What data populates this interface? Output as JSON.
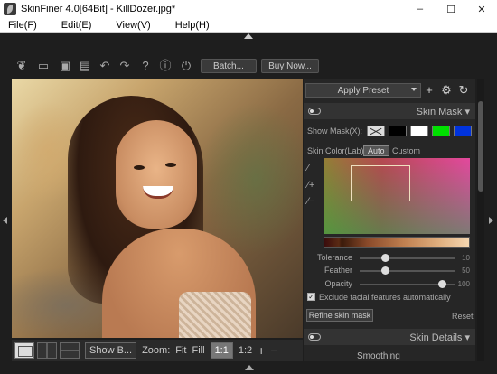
{
  "window": {
    "title": "SkinFiner 4.0[64Bit] - KillDozer.jpg*",
    "minimize": "–",
    "maximize": "☐",
    "close": "✕"
  },
  "menu": [
    "File(F)",
    "Edit(E)",
    "View(V)",
    "Help(H)"
  ],
  "toolbar": {
    "icons": [
      "leaf-icon",
      "folder-icon",
      "save-icon",
      "save-as-icon",
      "undo-icon",
      "redo-icon",
      "help-icon",
      "info-icon",
      "plugin-icon"
    ],
    "batch_label": "Batch...",
    "buy_label": "Buy Now..."
  },
  "bottom_bar": {
    "show_before_label": "Show B...",
    "zoom_label": "Zoom:",
    "fit_label": "Fit",
    "fill_label": "Fill",
    "one_to_one_label": "1:1",
    "one_to_two_label": "1:2",
    "zoom_in": "+",
    "zoom_out": "−"
  },
  "panel": {
    "preset_label": "Apply Preset",
    "skin_mask": {
      "title": "Skin Mask ▾",
      "show_mask_label": "Show Mask(X):",
      "skin_color_label": "Skin Color(Lab):",
      "tab_auto": "Auto",
      "tab_custom": "Custom",
      "swatches": [
        "#000000",
        "#ffffff",
        "#00e000",
        "#0033dd"
      ],
      "sliders": [
        {
          "label": "Tolerance",
          "value": "10",
          "fraction": 0.26
        },
        {
          "label": "Feather",
          "value": "50",
          "fraction": 0.26
        },
        {
          "label": "Opacity",
          "value": "100",
          "fraction": 0.86
        }
      ],
      "exclude_label": "Exclude facial features automatically",
      "exclude_checked": true,
      "refine_label": "Refine skin mask",
      "reset_label": "Reset"
    },
    "skin_details_title": "Skin Details ▾",
    "smoothing_label": "Smoothing"
  }
}
